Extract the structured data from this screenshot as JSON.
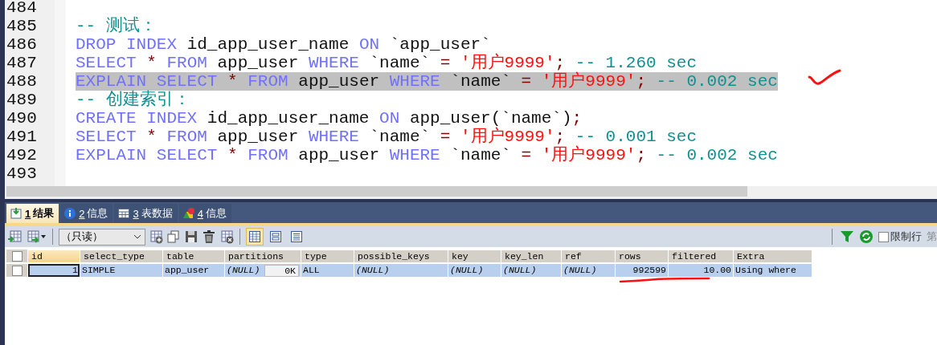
{
  "editor": {
    "lines": [
      {
        "number": "484",
        "highlighted": false
      },
      {
        "number": "485",
        "highlighted": false,
        "tokens": [
          {
            "kind": "comment",
            "text": "-- 测试："
          }
        ]
      },
      {
        "number": "486",
        "highlighted": false,
        "tokens": [
          {
            "kind": "keyword",
            "text": "DROP INDEX"
          },
          {
            "kind": "ident",
            "text": " id_app_user_name "
          },
          {
            "kind": "keyword",
            "text": "ON"
          },
          {
            "kind": "ident",
            "text": " `app_user`"
          }
        ]
      },
      {
        "number": "487",
        "highlighted": false,
        "tokens": [
          {
            "kind": "keyword",
            "text": "SELECT"
          },
          {
            "kind": "op",
            "text": " * "
          },
          {
            "kind": "keyword",
            "text": "FROM"
          },
          {
            "kind": "ident",
            "text": " app_user "
          },
          {
            "kind": "keyword",
            "text": "WHERE"
          },
          {
            "kind": "ident",
            "text": " `name` "
          },
          {
            "kind": "op",
            "text": "= "
          },
          {
            "kind": "string",
            "text": "'用户9999'"
          },
          {
            "kind": "op",
            "text": "; "
          },
          {
            "kind": "comment",
            "text": "-- 1.260 sec"
          }
        ]
      },
      {
        "number": "488",
        "highlighted": true,
        "tokens": [
          {
            "kind": "keyword",
            "text": "EXPLAIN SELECT"
          },
          {
            "kind": "op",
            "text": " * "
          },
          {
            "kind": "keyword",
            "text": "FROM"
          },
          {
            "kind": "ident",
            "text": " app_user "
          },
          {
            "kind": "keyword",
            "text": "WHERE"
          },
          {
            "kind": "ident",
            "text": " `name` "
          },
          {
            "kind": "op",
            "text": "= "
          },
          {
            "kind": "string",
            "text": "'用户9999'"
          },
          {
            "kind": "op",
            "text": "; "
          },
          {
            "kind": "comment",
            "text": "-- 0.002 sec"
          }
        ]
      },
      {
        "number": "489",
        "highlighted": false,
        "tokens": [
          {
            "kind": "comment",
            "text": "-- 创建索引："
          }
        ]
      },
      {
        "number": "490",
        "highlighted": false,
        "tokens": [
          {
            "kind": "keyword",
            "text": "CREATE INDEX"
          },
          {
            "kind": "ident",
            "text": " id_app_user_name "
          },
          {
            "kind": "keyword",
            "text": "ON"
          },
          {
            "kind": "ident",
            "text": " app_user(`name`)"
          },
          {
            "kind": "op",
            "text": ";"
          }
        ]
      },
      {
        "number": "491",
        "highlighted": false,
        "tokens": [
          {
            "kind": "keyword",
            "text": "SELECT"
          },
          {
            "kind": "op",
            "text": " * "
          },
          {
            "kind": "keyword",
            "text": "FROM"
          },
          {
            "kind": "ident",
            "text": " app_user "
          },
          {
            "kind": "keyword",
            "text": "WHERE"
          },
          {
            "kind": "ident",
            "text": " `name` "
          },
          {
            "kind": "op",
            "text": "= "
          },
          {
            "kind": "string",
            "text": "'用户9999'"
          },
          {
            "kind": "op",
            "text": "; "
          },
          {
            "kind": "comment",
            "text": "-- 0.001 sec"
          }
        ]
      },
      {
        "number": "492",
        "highlighted": false,
        "tokens": [
          {
            "kind": "keyword",
            "text": "EXPLAIN SELECT"
          },
          {
            "kind": "op",
            "text": " * "
          },
          {
            "kind": "keyword",
            "text": "FROM"
          },
          {
            "kind": "ident",
            "text": " app_user "
          },
          {
            "kind": "keyword",
            "text": "WHERE"
          },
          {
            "kind": "ident",
            "text": " `name` "
          },
          {
            "kind": "op",
            "text": "= "
          },
          {
            "kind": "string",
            "text": "'用户9999'"
          },
          {
            "kind": "op",
            "text": "; "
          },
          {
            "kind": "comment",
            "text": "-- 0.002 sec"
          }
        ]
      },
      {
        "number": "493",
        "highlighted": false
      }
    ]
  },
  "tabs": [
    {
      "kind": "result",
      "number": "1",
      "label": "结果",
      "selected": true
    },
    {
      "kind": "info",
      "number": "2",
      "label": "信息",
      "selected": false
    },
    {
      "kind": "table",
      "number": "3",
      "label": "表数据",
      "selected": false
    },
    {
      "kind": "shapes",
      "number": "4",
      "label": "信息",
      "selected": false
    }
  ],
  "toolbar": {
    "mode_select": {
      "value": "（只读）"
    },
    "view_modes": [
      {
        "kind": "grid",
        "selected": true
      },
      {
        "kind": "form",
        "selected": false
      },
      {
        "kind": "text",
        "selected": false
      }
    ],
    "limit_rows": {
      "label": "限制行",
      "checked": false
    },
    "cut_label": "第"
  },
  "table": {
    "all_checked": false,
    "columns": [
      {
        "name": "id",
        "numeric": true
      },
      {
        "name": "select_type",
        "numeric": false
      },
      {
        "name": "table",
        "numeric": false
      },
      {
        "name": "partitions",
        "numeric": false
      },
      {
        "name": "type",
        "numeric": false
      },
      {
        "name": "possible_keys",
        "numeric": false
      },
      {
        "name": "key",
        "numeric": false
      },
      {
        "name": "key_len",
        "numeric": false
      },
      {
        "name": "ref",
        "numeric": false
      },
      {
        "name": "rows",
        "numeric": true
      },
      {
        "name": "filtered",
        "numeric": true
      },
      {
        "name": "Extra",
        "numeric": false
      }
    ],
    "rows": [
      {
        "selected": true,
        "checked": false,
        "cells": [
          {
            "text": "1",
            "italic": false,
            "focused": true
          },
          {
            "text": "SIMPLE",
            "italic": false,
            "focused": false
          },
          {
            "text": "app_user",
            "italic": false,
            "focused": false
          },
          {
            "text": "(NULL)",
            "italic": true,
            "focused": false,
            "size_badge": "0K"
          },
          {
            "text": "ALL",
            "italic": false,
            "focused": false
          },
          {
            "text": "(NULL)",
            "italic": true,
            "focused": false
          },
          {
            "text": "(NULL)",
            "italic": true,
            "focused": false
          },
          {
            "text": "(NULL)",
            "italic": true,
            "focused": false
          },
          {
            "text": "(NULL)",
            "italic": true,
            "focused": false
          },
          {
            "text": "992599",
            "italic": false,
            "focused": false
          },
          {
            "text": "10.00",
            "italic": false,
            "focused": false
          },
          {
            "text": "Using where",
            "italic": false,
            "focused": false
          }
        ]
      }
    ]
  }
}
